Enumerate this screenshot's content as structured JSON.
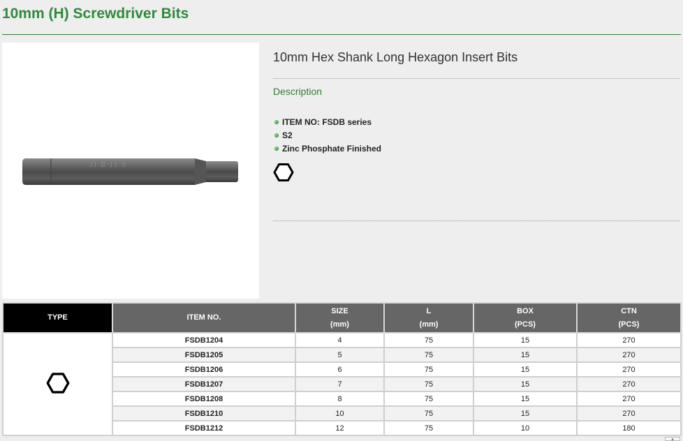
{
  "page": {
    "title": "10mm (H) Screwdriver Bits"
  },
  "product": {
    "name": "10mm Hex Shank Long Hexagon Insert Bits",
    "description_label": "Description",
    "features": [
      "ITEM NO: FSDB series",
      "S2",
      "Zinc Phosphate Finished"
    ],
    "image_icon": "hex-bit-image",
    "profile_icon": "hexagon-icon"
  },
  "table": {
    "headers": {
      "type": "TYPE",
      "item_no": "ITEM NO.",
      "size": "SIZE",
      "size_unit": "(mm)",
      "length": "L",
      "length_unit": "(mm)",
      "box": "BOX",
      "box_unit": "(PCS)",
      "ctn": "CTN",
      "ctn_unit": "(PCS)"
    },
    "type_icon": "hexagon-icon",
    "rows": [
      {
        "item": "FSDB1204",
        "size": "4",
        "l": "75",
        "box": "15",
        "ctn": "270"
      },
      {
        "item": "FSDB1205",
        "size": "5",
        "l": "75",
        "box": "15",
        "ctn": "270"
      },
      {
        "item": "FSDB1206",
        "size": "6",
        "l": "75",
        "box": "15",
        "ctn": "270"
      },
      {
        "item": "FSDB1207",
        "size": "7",
        "l": "75",
        "box": "15",
        "ctn": "270"
      },
      {
        "item": "FSDB1208",
        "size": "8",
        "l": "75",
        "box": "15",
        "ctn": "270"
      },
      {
        "item": "FSDB1210",
        "size": "10",
        "l": "75",
        "box": "15",
        "ctn": "270"
      },
      {
        "item": "FSDB1212",
        "size": "12",
        "l": "75",
        "box": "10",
        "ctn": "180"
      }
    ]
  },
  "colors": {
    "brand_green": "#2e8b3a",
    "header_gray": "#666666",
    "type_header_black": "#000000"
  }
}
